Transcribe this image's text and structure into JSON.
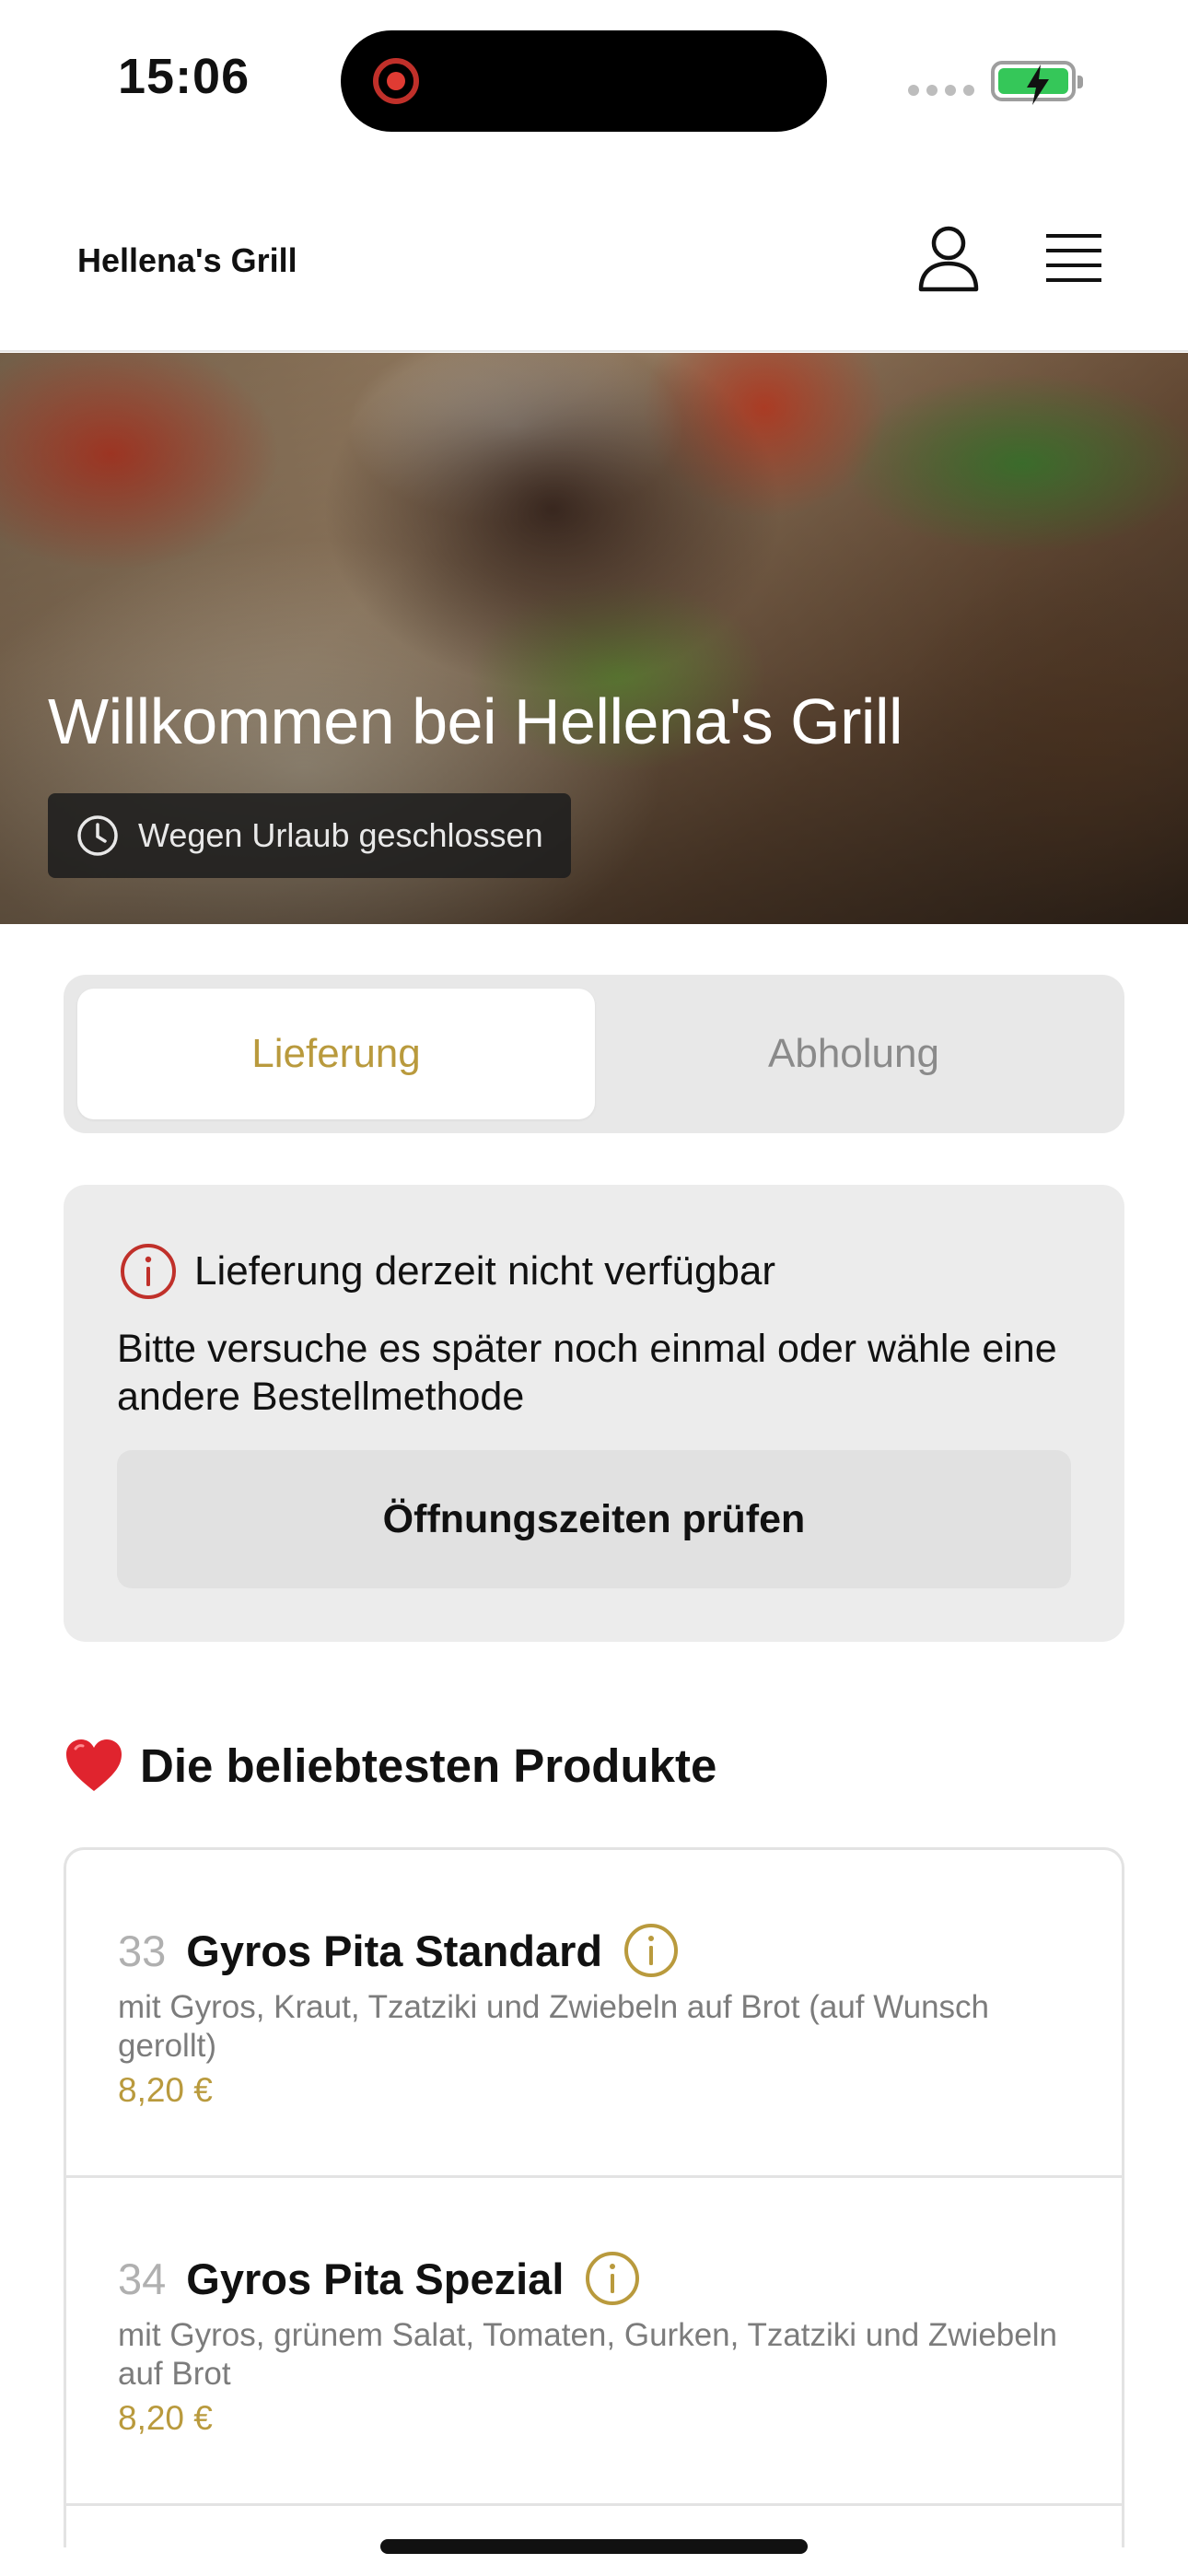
{
  "status_bar": {
    "time": "15:06",
    "battery_state": "charging",
    "battery_color": "#35c759",
    "recording_color": "#e03b33"
  },
  "header": {
    "brand": "Hellena's Grill",
    "user_icon": "user-icon",
    "menu_icon": "hamburger-menu-icon"
  },
  "hero": {
    "title": "Willkommen bei Hellena's Grill",
    "status_badge": "Wegen Urlaub geschlossen",
    "status_icon": "clock-icon"
  },
  "order_method": {
    "tabs": [
      {
        "label": "Lieferung",
        "selected": true
      },
      {
        "label": "Abholung",
        "selected": false
      }
    ],
    "accent_color": "#b99a3d"
  },
  "notice": {
    "icon": "info-circle-icon",
    "icon_color": "#c0302a",
    "title": "Lieferung derzeit nicht verfügbar",
    "body": "Bitte versuche es später noch einmal oder wähle eine andere Bestellmethode",
    "button_label": "Öffnungszeiten prüfen"
  },
  "popular": {
    "emoji": "❤️",
    "title": "Die beliebtesten Produkte",
    "products": [
      {
        "number": "33",
        "name": "Gyros Pita Standard",
        "description": "mit Gyros, Kraut, Tzatziki und Zwiebeln auf Brot (auf Wunsch gerollt)",
        "price": "8,20 €"
      },
      {
        "number": "34",
        "name": "Gyros Pita Spezial",
        "description": "mit Gyros, grünem Salat, Tomaten, Gurken, Tzatziki und Zwiebeln auf Brot",
        "price": "8,20 €"
      }
    ]
  }
}
